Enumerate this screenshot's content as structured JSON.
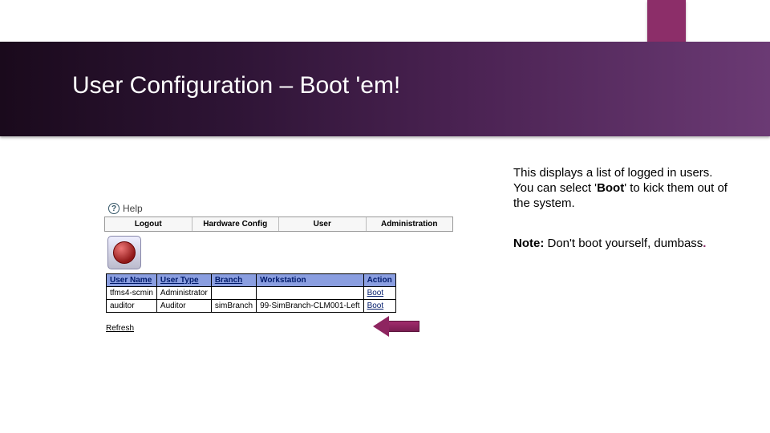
{
  "slide": {
    "title": "User Configuration – Boot 'em!"
  },
  "description": {
    "line1_pre": "This displays a list of logged in users. You can select '",
    "line1_bold": "Boot",
    "line1_post": "' to kick them out of the system."
  },
  "note": {
    "label": "Note:",
    "text": " Don't boot yourself, dumbass",
    "dot": "."
  },
  "app": {
    "help": "Help",
    "menu": [
      "Logout",
      "Hardware Config",
      "User",
      "Administration"
    ],
    "refresh": "Refresh",
    "table": {
      "headers": [
        "User Name",
        "User Type",
        "Branch",
        "Workstation",
        "Action"
      ],
      "rows": [
        {
          "user": "tfms4-scmin",
          "type": "Administrator",
          "branch": "",
          "workstation": "",
          "action": "Boot"
        },
        {
          "user": "auditor",
          "type": "Auditor",
          "branch": "simBranch",
          "workstation": "99-SimBranch-CLM001-Left",
          "action": "Boot"
        }
      ]
    }
  }
}
